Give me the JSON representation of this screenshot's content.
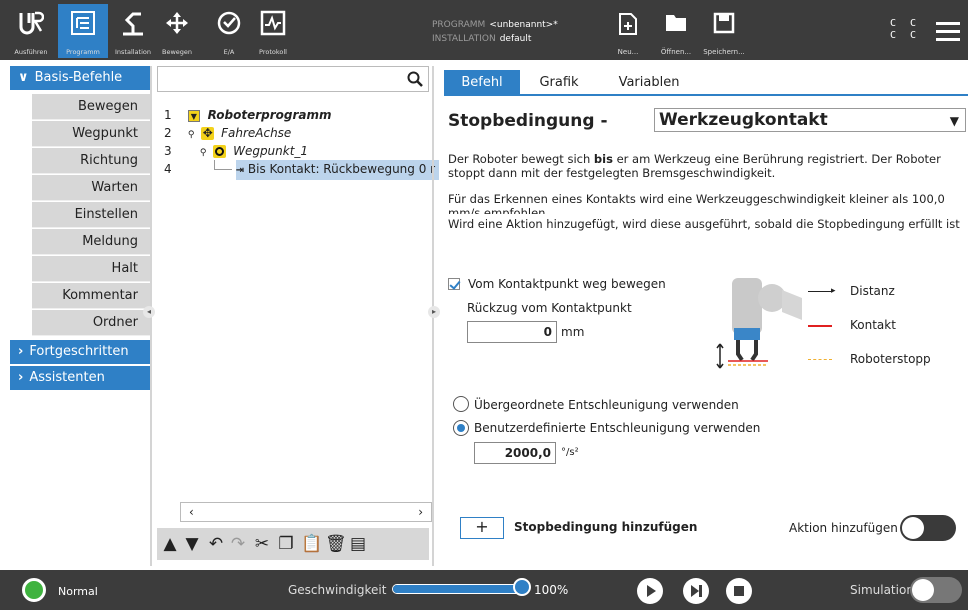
{
  "header": {
    "nav": [
      {
        "label": "Ausführen",
        "icon": "ur-logo-icon"
      },
      {
        "label": "Programm",
        "icon": "program-tree-icon",
        "active": true
      },
      {
        "label": "Installation",
        "icon": "installation-icon"
      },
      {
        "label": "Bewegen",
        "icon": "move-arrows-icon"
      },
      {
        "label": "E/A",
        "icon": "io-icon"
      },
      {
        "label": "Protokoll",
        "icon": "log-icon"
      }
    ],
    "program_label": "PROGRAMM",
    "program_value": "<unbenannt>*",
    "installation_label": "INSTALLATION",
    "installation_value": "default",
    "file": {
      "new": "Neu...",
      "open": "Öffnen...",
      "save": "Speichern..."
    },
    "cc_line1": "C C",
    "cc_line2": "C C"
  },
  "leftnav": {
    "basis": "Basis-Befehle",
    "items": [
      "Bewegen",
      "Wegpunkt",
      "Richtung",
      "Warten",
      "Einstellen",
      "Meldung",
      "Halt",
      "Kommentar",
      "Ordner"
    ],
    "fortgeschritten": "Fortgeschritten",
    "assistenten": "Assistenten"
  },
  "tree": {
    "search_placeholder": "",
    "rows": [
      {
        "num": "1",
        "text": "Roboterprogramm"
      },
      {
        "num": "2",
        "text": "FahreAchse"
      },
      {
        "num": "3",
        "text": "Wegpunkt_1"
      },
      {
        "num": "4",
        "text": "Bis Kontakt: Rückbewegung 0 r"
      }
    ]
  },
  "tabs": [
    "Befehl",
    "Grafik",
    "Variablen"
  ],
  "main": {
    "title": "Stopbedingung -",
    "selected_condition": "Werkzeugkontakt",
    "p1_a": "Der Roboter bewegt sich ",
    "p1_b": "bis",
    "p1_c": " er am Werkzeug eine Berührung registriert. Der Roboter stoppt dann mit der festgelegten Bremsgeschwindigkeit.",
    "p2": "Für das Erkennen eines Kontakts wird eine Werkzeuggeschwindigkeit kleiner als 100,0 mm/s empfohlen",
    "p3": "Wird eine Aktion hinzugefügt, wird diese ausgeführt, sobald die Stopbedingung erfüllt ist",
    "checkbox_label": "Vom Kontaktpunkt weg bewegen",
    "retract_label": "Rückzug vom Kontaktpunkt",
    "retract_value": "0",
    "retract_unit": "mm",
    "legend_distance": "Distanz",
    "legend_contact": "Kontakt",
    "legend_stop": "Roboterstopp",
    "radio1": "Übergeordnete Entschleunigung verwenden",
    "radio2": "Benutzerdefinierte Entschleunigung verwenden",
    "decel_value": "2000,0",
    "decel_unit": "°/s²",
    "add_cond_symbol": "+",
    "add_cond_label": "Stopbedingung hinzufügen",
    "add_action_label": "Aktion hinzufügen"
  },
  "bottom": {
    "status": "Normal",
    "speed_label": "Geschwindigkeit",
    "speed_value": "100%",
    "speed_fraction": 1.0,
    "simulation_label": "Simulation"
  },
  "colors": {
    "accent": "#2f80c6",
    "bar": "#3c3c3c",
    "contact": "#e02020",
    "stop": "#f0b030",
    "status_led": "#3fb33f"
  }
}
